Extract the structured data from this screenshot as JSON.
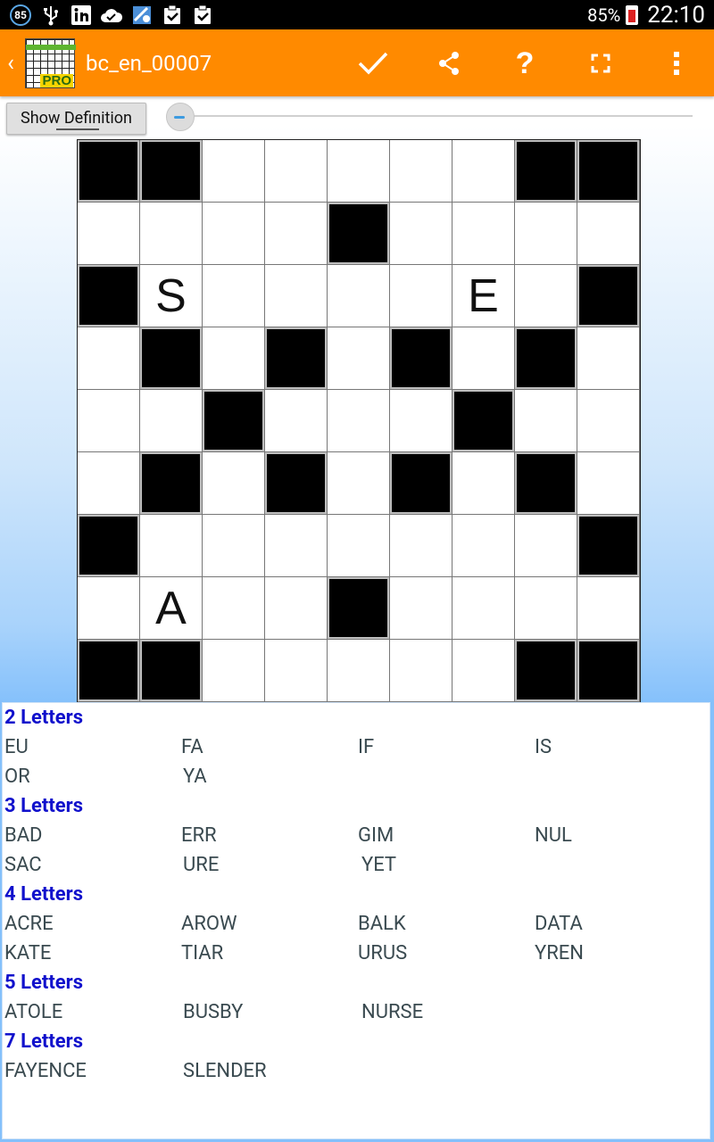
{
  "status_bar": {
    "notification_count": "85",
    "battery_percent": "85%",
    "time": "22:10",
    "icons": [
      "usb-icon",
      "linkedin-icon",
      "cloud-check-icon",
      "vpn-icon",
      "clipboard-check-icon",
      "clipboard-check-icon"
    ]
  },
  "action_bar": {
    "title": "bc_en_00007",
    "logo_badge": "PRO",
    "accent_color": "#ff8a00",
    "actions": [
      "check-icon",
      "share-icon",
      "help-icon",
      "fullscreen-icon",
      "overflow-menu-icon"
    ]
  },
  "toolbar": {
    "show_definition_label": "Show Definition",
    "slider_value": 0
  },
  "grid": {
    "size": 9,
    "rows": [
      "##.....##",
      "....#....",
      "#S....E.#",
      ".#.#.#.#.",
      "..#...#..",
      ".#.#.#.#.",
      "#.......#",
      ".A..#....",
      "##.....##"
    ]
  },
  "word_list": [
    {
      "header": "2 Letters",
      "rows": [
        [
          "EU",
          "FA",
          "IF",
          "IS"
        ],
        [
          "OR",
          "YA"
        ]
      ]
    },
    {
      "header": "3 Letters",
      "rows": [
        [
          "BAD",
          "ERR",
          "GIM",
          "NUL"
        ],
        [
          "SAC",
          "URE",
          "YET"
        ]
      ]
    },
    {
      "header": "4 Letters",
      "rows": [
        [
          "ACRE",
          "AROW",
          "BALK",
          "DATA"
        ],
        [
          "KATE",
          "TIAR",
          "URUS",
          "YREN"
        ]
      ]
    },
    {
      "header": "5 Letters",
      "rows": [
        [
          "ATOLE",
          "BUSBY",
          "NURSE"
        ]
      ]
    },
    {
      "header": "7 Letters",
      "rows": [
        [
          "FAYENCE",
          "SLENDER"
        ]
      ]
    }
  ]
}
